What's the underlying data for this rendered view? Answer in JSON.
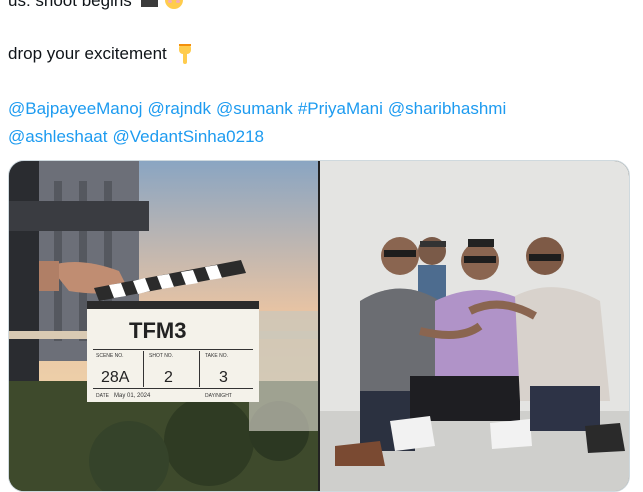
{
  "tweet": {
    "line1": "us: shoot begins",
    "line2": "drop your excitement",
    "mentions": [
      "@BajpayeeManoj",
      "@rajndk",
      "@sumank",
      "#PriyaMani",
      "@sharibhashmi",
      "@ashleshaat",
      "@VedantSinha0218"
    ]
  },
  "media": {
    "photo1": {
      "slate_title": "TFM3",
      "slate_scene_label": "SCENE NO.",
      "slate_shot_label": "SHOT NO.",
      "slate_take_label": "TAKE NO.",
      "scene": "28A",
      "shot": "2",
      "take": "3",
      "date_label": "DATE",
      "date": "May 01, 2024",
      "day_night_label": "DAY/NIGHT"
    }
  },
  "icons": {
    "clapper": "clapper-board-icon",
    "face": "smiling-face-icon",
    "hand": "backhand-index-pointing-down-icon"
  },
  "colors": {
    "link": "#1d9bf0",
    "text": "#0f1419",
    "border": "#cfd9de"
  }
}
